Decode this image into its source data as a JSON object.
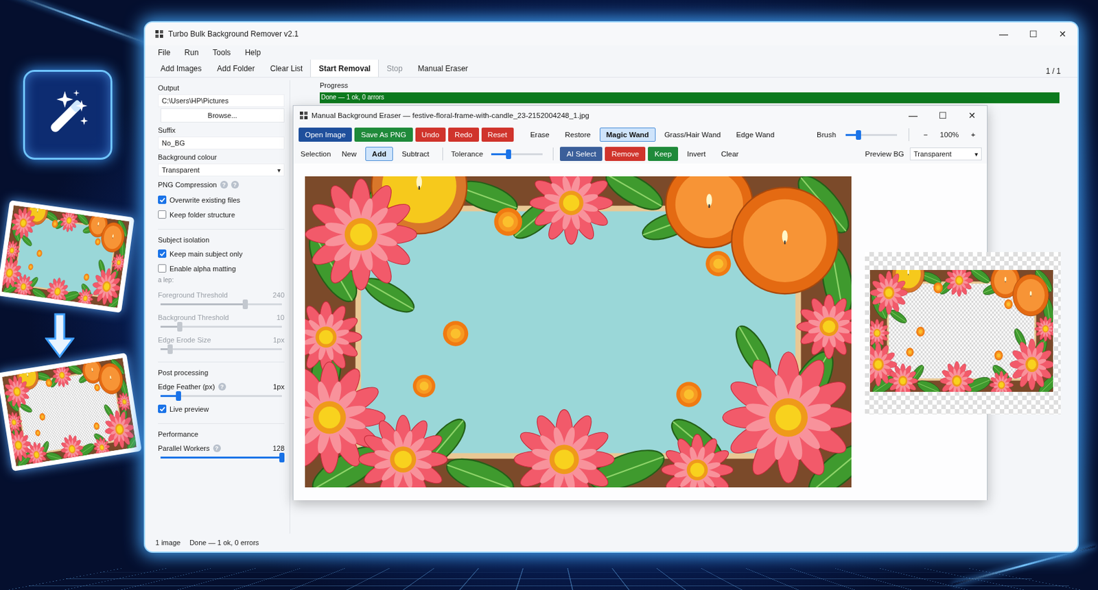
{
  "app_window": {
    "title": "Turbo Bulk Background Remover v2.1",
    "controls": [
      "—",
      "☐",
      "✕"
    ]
  },
  "menu": [
    "File",
    "Run",
    "Tools",
    "Help"
  ],
  "toolbar": [
    {
      "label": "Add Images",
      "selected": false,
      "disabled": false
    },
    {
      "label": "Add Folder",
      "selected": false,
      "disabled": false
    },
    {
      "label": "Clear List",
      "selected": false,
      "disabled": false
    },
    {
      "label": "Start Removal",
      "selected": true,
      "disabled": false
    },
    {
      "label": "Stop",
      "selected": false,
      "disabled": true
    },
    {
      "label": "Manual Eraser",
      "selected": false,
      "disabled": false
    }
  ],
  "queue_count": "1 / 1",
  "progress": {
    "label": "Progress",
    "level": 1,
    "text": "Done — 1 ok, 0 arrors"
  },
  "settings": [
    {
      "kind": "heading",
      "label": "Output"
    },
    {
      "kind": "field",
      "value": "C:\\Users\\HP\\Pictures"
    },
    {
      "kind": "button",
      "label": "Browse..."
    },
    {
      "kind": "heading",
      "label": "Suffix"
    },
    {
      "kind": "field",
      "value": "No_BG"
    },
    {
      "kind": "heading",
      "label": "Background colour"
    },
    {
      "kind": "select",
      "value": "Transparent",
      "arrow": "▾"
    },
    {
      "kind": "help",
      "label": "PNG Compression",
      "help": [
        "?",
        "?"
      ]
    },
    {
      "kind": "checkbox",
      "label": "Overwrite existing files",
      "checked": true
    },
    {
      "kind": "checkbox",
      "label": "Keep folder structure",
      "checked": false
    },
    {
      "kind": "section",
      "label": "Subject isolation"
    },
    {
      "kind": "checkbox",
      "label": "Keep main subject only",
      "checked": true
    },
    {
      "kind": "checkbox",
      "label": "Enable alpha matting",
      "checked": false
    },
    {
      "kind": "note",
      "label": "a lep:"
    },
    {
      "kind": "slider",
      "label": "Foreground Threshold",
      "help": [],
      "reading": "240",
      "level": 0.7,
      "disabled": true
    },
    {
      "kind": "slider",
      "label": "Background Threshold",
      "help": [],
      "reading": "10",
      "level": 0.16,
      "disabled": true
    },
    {
      "kind": "slider",
      "label": "Edge Erode Size",
      "help": [],
      "reading": "1px",
      "level": 0.08,
      "disabled": true
    },
    {
      "kind": "section",
      "label": "Post processing"
    },
    {
      "kind": "slider",
      "label": "Edge Feather (px)",
      "help": [
        "?"
      ],
      "reading": "1px",
      "level": 0.15,
      "disabled": false
    },
    {
      "kind": "checkbox",
      "label": "Live preview",
      "checked": true
    },
    {
      "kind": "section",
      "label": "Performance"
    },
    {
      "kind": "slider",
      "label": "Parallel Workers",
      "help": [
        "?"
      ],
      "reading": "128",
      "level": 1,
      "disabled": false
    }
  ],
  "status_bar": {
    "count": "1 image",
    "text": "Done — 1 ok, 0 errors"
  },
  "eraser": {
    "title": "Manual Background Eraser — festive-floral-frame-with-candle_23-2152004248_1.jpg",
    "controls": [
      "—",
      "☐",
      "✕"
    ],
    "buttons": [
      {
        "label": "Open Image",
        "kind": "primary",
        "selected": false
      },
      {
        "label": "Save As PNG",
        "kind": "success",
        "selected": false
      },
      {
        "label": "Undo",
        "kind": "danger",
        "selected": false
      },
      {
        "label": "Redo",
        "kind": "danger",
        "selected": false
      },
      {
        "label": "Reset",
        "kind": "danger",
        "selected": false
      },
      {
        "label": "Erase",
        "kind": "tool",
        "selected": false
      },
      {
        "label": "Restore",
        "kind": "tool",
        "selected": false
      },
      {
        "label": "Magic Wand",
        "kind": "tool",
        "selected": true
      },
      {
        "label": "Grass/Hair Wand",
        "kind": "tool",
        "selected": false
      },
      {
        "label": "Edge Wand",
        "kind": "tool",
        "selected": false
      }
    ],
    "brush": {
      "label": "Brush",
      "level": 0.25,
      "minus": "−",
      "zoom": "100%",
      "plus": "+"
    },
    "selection": {
      "label": "Selection",
      "modes": [
        {
          "label": "New",
          "selected": false
        },
        {
          "label": "Add",
          "selected": true
        },
        {
          "label": "Subtract",
          "selected": false
        }
      ]
    },
    "tolerance": {
      "label": "Tolerance",
      "level": 0.33
    },
    "actions": [
      {
        "label": "AI Select",
        "kind": "steel"
      },
      {
        "label": "Remove",
        "kind": "danger"
      },
      {
        "label": "Keep",
        "kind": "success"
      },
      {
        "label": "Invert",
        "kind": "tool"
      },
      {
        "label": "Clear",
        "kind": "tool"
      }
    ],
    "preview_bg": {
      "label": "Preview BG",
      "value": "Transparent",
      "arrow": "▾"
    }
  }
}
